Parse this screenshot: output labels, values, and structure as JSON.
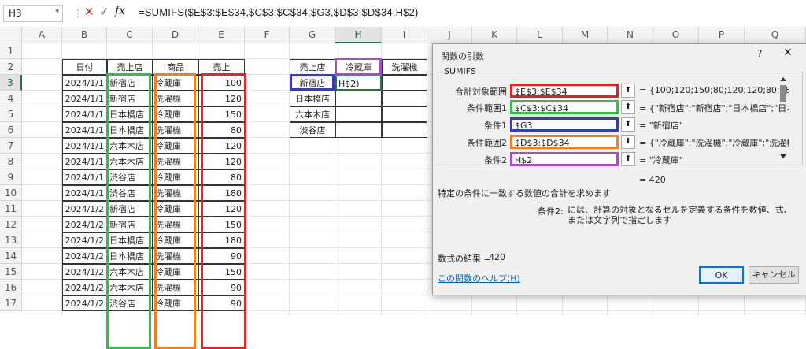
{
  "formula_bar": {
    "name_box": "H3",
    "formula": "=SUMIFS($E$3:$E$34,$C$3:$C$34,$G3,$D$3:$D$34,H$2)"
  },
  "columns": [
    "A",
    "B",
    "C",
    "D",
    "E",
    "F",
    "G",
    "H",
    "I",
    "J",
    "K",
    "L",
    "M",
    "N",
    "O",
    "P",
    "Q"
  ],
  "rows": [
    "1",
    "2",
    "3",
    "4",
    "5",
    "6",
    "7",
    "8",
    "9",
    "10",
    "11",
    "12",
    "13",
    "14",
    "15",
    "16",
    "17"
  ],
  "table": {
    "headers": [
      "日付",
      "売上店",
      "商品",
      "売上"
    ],
    "rows": [
      [
        "2024/1/1",
        "新宿店",
        "冷蔵庫",
        "100"
      ],
      [
        "2024/1/1",
        "新宿店",
        "洗濯機",
        "120"
      ],
      [
        "2024/1/1",
        "日本橋店",
        "冷蔵庫",
        "150"
      ],
      [
        "2024/1/1",
        "日本橋店",
        "洗濯機",
        "80"
      ],
      [
        "2024/1/1",
        "六本木店",
        "冷蔵庫",
        "120"
      ],
      [
        "2024/1/1",
        "六本木店",
        "洗濯機",
        "120"
      ],
      [
        "2024/1/1",
        "渋谷店",
        "冷蔵庫",
        "80"
      ],
      [
        "2024/1/1",
        "渋谷店",
        "洗濯機",
        "180"
      ],
      [
        "2024/1/2",
        "新宿店",
        "冷蔵庫",
        "120"
      ],
      [
        "2024/1/2",
        "新宿店",
        "洗濯機",
        "150"
      ],
      [
        "2024/1/2",
        "日本橋店",
        "冷蔵庫",
        "180"
      ],
      [
        "2024/1/2",
        "日本橋店",
        "洗濯機",
        "90"
      ],
      [
        "2024/1/2",
        "六本木店",
        "冷蔵庫",
        "150"
      ],
      [
        "2024/1/2",
        "六本木店",
        "洗濯機",
        "90"
      ],
      [
        "2024/1/2",
        "渋谷店",
        "冷蔵庫",
        "90"
      ]
    ]
  },
  "summary": {
    "headers": [
      "売上店",
      "冷蔵庫",
      "洗濯機"
    ],
    "stores": [
      "新宿店",
      "日本橋店",
      "六本木店",
      "渋谷店"
    ],
    "active_value": "H$2)"
  },
  "dialog": {
    "title": "関数の引数",
    "help_symbol": "?",
    "close_symbol": "✕",
    "function_name": "SUMIFS",
    "args": [
      {
        "label": "合計対象範囲",
        "value": "$E$3:$E$34",
        "result": "{100;120;150;80;120;120;80;180;"
      },
      {
        "label": "条件範囲1",
        "value": "$C$3:$C$34",
        "result": "{\"新宿店\";\"新宿店\";\"日本橋店\";\"日本"
      },
      {
        "label": "条件1",
        "value": "$G3",
        "result": "\"新宿店\""
      },
      {
        "label": "条件範囲2",
        "value": "$D$3:$D$34",
        "result": "{\"冷蔵庫\";\"洗濯機\";\"冷蔵庫\";\"洗濯機"
      },
      {
        "label": "条件2",
        "value": "H$2",
        "result": "\"冷蔵庫\""
      }
    ],
    "equals": "=",
    "func_result": "420",
    "description": "特定の条件に一致する数値の合計を求めます",
    "arg_name": "条件2:",
    "arg_desc": "には、計算の対象となるセルを定義する条件を数値、式、または文字列で指定します",
    "formula_result_label": "数式の結果 =",
    "formula_result": "420",
    "help_link": "この関数のヘルプ(H)",
    "ok": "OK",
    "cancel": "キャンセル"
  },
  "highlight_colors": {
    "sum": "#e0242b",
    "crit1": "#2dbf4a",
    "cond1": "#3a3ab5",
    "crit2": "#f07f22",
    "cond2": "#a64fc4"
  }
}
